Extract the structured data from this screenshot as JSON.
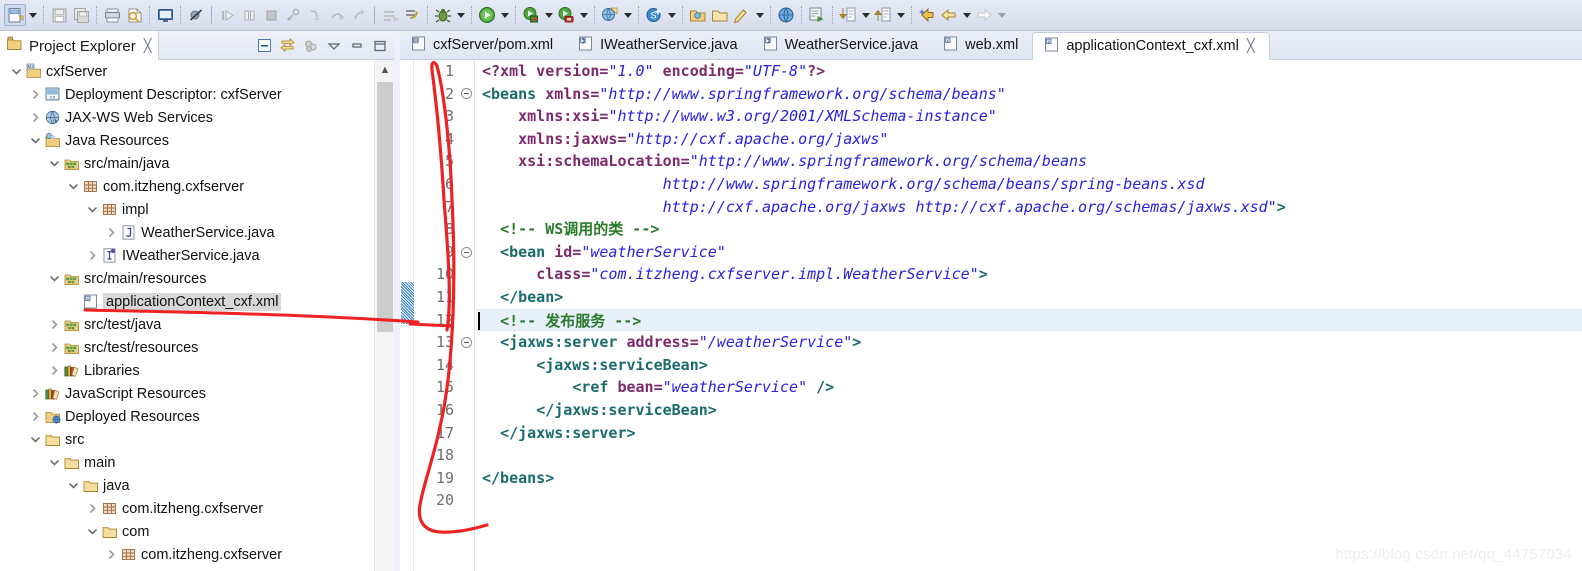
{
  "toolbar": {
    "groups": [
      {
        "name": "new",
        "items": [
          {
            "icon": "new-file-icon",
            "label": "New",
            "selected": true
          },
          {
            "icon": "chevron-down-icon",
            "label": "New menu",
            "type": "arrow"
          }
        ]
      },
      {
        "name": "save",
        "items": [
          {
            "icon": "save-icon",
            "label": "Save",
            "disabled": true
          },
          {
            "icon": "save-all-icon",
            "label": "Save All",
            "disabled": true
          }
        ]
      },
      {
        "name": "print",
        "items": [
          {
            "icon": "print-icon",
            "label": "Print"
          },
          {
            "icon": "build-icon",
            "label": "Build"
          }
        ]
      },
      {
        "name": "console",
        "items": [
          {
            "icon": "console-icon",
            "label": "Open Console"
          }
        ]
      },
      {
        "name": "breakpoint",
        "items": [
          {
            "icon": "skip-breakpoints-icon",
            "label": "Skip All Breakpoints"
          }
        ]
      },
      {
        "name": "debug-step",
        "items": [
          {
            "icon": "resume-icon",
            "label": "Resume",
            "disabled": true
          },
          {
            "icon": "suspend-icon",
            "label": "Suspend",
            "disabled": true
          },
          {
            "icon": "terminate-icon",
            "label": "Terminate",
            "disabled": true
          },
          {
            "icon": "disconnect-icon",
            "label": "Disconnect",
            "disabled": true
          },
          {
            "icon": "step-into-icon",
            "label": "Step Into",
            "disabled": true
          },
          {
            "icon": "step-over-icon",
            "label": "Step Over",
            "disabled": true
          },
          {
            "icon": "step-return-icon",
            "label": "Step Return",
            "disabled": true
          }
        ]
      },
      {
        "name": "instance",
        "items": [
          {
            "icon": "new-instance-icon",
            "label": "New Instance",
            "disabled": true
          },
          {
            "icon": "deploy-icon",
            "label": "Deploy",
            "disabled": true
          }
        ]
      },
      {
        "name": "debug",
        "items": [
          {
            "icon": "debug-bug-icon",
            "label": "Debug"
          },
          {
            "icon": "chevron-down-icon",
            "label": "Debug menu",
            "type": "arrow"
          }
        ]
      },
      {
        "name": "run",
        "items": [
          {
            "icon": "run-icon",
            "label": "Run"
          },
          {
            "icon": "chevron-down-icon",
            "label": "Run menu",
            "type": "arrow"
          }
        ]
      },
      {
        "name": "run-server",
        "items": [
          {
            "icon": "run-server-icon",
            "label": "Run on Server"
          },
          {
            "icon": "chevron-down-icon",
            "label": "Run on Server menu",
            "type": "arrow"
          }
        ]
      },
      {
        "name": "stop-server",
        "items": [
          {
            "icon": "stop-server-icon",
            "label": "Stop Server"
          },
          {
            "icon": "chevron-down-icon",
            "label": "Stop Server menu",
            "type": "arrow"
          }
        ]
      },
      {
        "name": "profile-server",
        "items": [
          {
            "icon": "profile-server-icon",
            "label": "Profile Server"
          },
          {
            "icon": "chevron-down-icon",
            "label": "Profile menu",
            "type": "arrow"
          }
        ]
      },
      {
        "name": "new-wizard",
        "items": [
          {
            "icon": "new-web-project-icon",
            "label": "New Web Project"
          },
          {
            "icon": "chevron-down-icon",
            "label": "New project menu",
            "type": "arrow"
          }
        ]
      },
      {
        "name": "search-svn",
        "items": [
          {
            "icon": "svn-icon",
            "label": "SVN"
          },
          {
            "icon": "chevron-down-icon",
            "label": "SVN menu",
            "type": "arrow"
          }
        ]
      },
      {
        "name": "open-type",
        "items": [
          {
            "icon": "open-type-icon",
            "label": "Open Type"
          },
          {
            "icon": "open-task-icon",
            "label": "Open Task"
          },
          {
            "icon": "new-java-class-icon",
            "label": "New Java Class"
          },
          {
            "icon": "chevron-down-icon",
            "label": "New class menu",
            "type": "arrow"
          }
        ]
      },
      {
        "name": "web-browser",
        "items": [
          {
            "icon": "web-browser-icon",
            "label": "Open Web Browser"
          }
        ]
      },
      {
        "name": "search",
        "items": [
          {
            "icon": "search-icon",
            "label": "Search"
          }
        ]
      },
      {
        "name": "next-annotation",
        "items": [
          {
            "icon": "next-annotation-icon",
            "label": "Next Annotation"
          },
          {
            "icon": "chevron-down-icon",
            "label": "Next annotation menu",
            "type": "arrow"
          }
        ]
      },
      {
        "name": "prev-annotation",
        "items": [
          {
            "icon": "previous-annotation-icon",
            "label": "Previous Annotation"
          },
          {
            "icon": "chevron-down-icon",
            "label": "Previous annotation menu",
            "type": "arrow"
          }
        ]
      },
      {
        "name": "nav-history",
        "items": [
          {
            "icon": "last-edit-location-icon",
            "label": "Last Edit Location"
          },
          {
            "icon": "back-icon",
            "label": "Back"
          },
          {
            "icon": "chevron-down-icon",
            "label": "Back menu",
            "type": "arrow"
          },
          {
            "icon": "forward-icon",
            "label": "Forward",
            "disabled": true
          },
          {
            "icon": "chevron-down-icon",
            "label": "Forward menu",
            "type": "arrow",
            "disabled": true
          }
        ]
      }
    ]
  },
  "explorer": {
    "title": "Project Explorer",
    "title_icon": "project-explorer-icon",
    "close_glyph": "╳",
    "tools": [
      {
        "icon": "collapse-all-icon",
        "label": "Collapse All"
      },
      {
        "icon": "link-with-editor-icon",
        "label": "Link with Editor"
      },
      {
        "icon": "focus-on-active-task-icon",
        "label": "Focus on Active Task",
        "disabled": true
      },
      {
        "icon": "view-menu-icon",
        "label": "View Menu"
      },
      {
        "icon": "minimize-icon",
        "label": "Minimize"
      },
      {
        "icon": "maximize-icon",
        "label": "Maximize"
      }
    ],
    "tree": [
      {
        "label": "cxfServer",
        "indent": 0,
        "twisty": "down",
        "icon": "maven-java-project-icon"
      },
      {
        "label": "Deployment Descriptor: cxfServer",
        "indent": 1,
        "twisty": "right",
        "icon": "deployment-descriptor-icon"
      },
      {
        "label": "JAX-WS Web Services",
        "indent": 1,
        "twisty": "right",
        "icon": "jaxws-web-services-icon"
      },
      {
        "label": "Java Resources",
        "indent": 1,
        "twisty": "down",
        "icon": "java-resources-icon"
      },
      {
        "label": "src/main/java",
        "indent": 2,
        "twisty": "down",
        "icon": "source-folder-icon"
      },
      {
        "label": "com.itzheng.cxfserver",
        "indent": 3,
        "twisty": "down",
        "icon": "package-icon"
      },
      {
        "label": "impl",
        "indent": 4,
        "twisty": "down",
        "icon": "package-icon"
      },
      {
        "label": "WeatherService.java",
        "indent": 5,
        "twisty": "right",
        "icon": "java-class-icon"
      },
      {
        "label": "IWeatherService.java",
        "indent": 4,
        "twisty": "right",
        "icon": "java-interface-icon"
      },
      {
        "label": "src/main/resources",
        "indent": 2,
        "twisty": "down",
        "icon": "source-folder-icon"
      },
      {
        "label": "applicationContext_cxf.xml",
        "indent": 3,
        "twisty": "none",
        "icon": "xml-file-icon",
        "selected": true
      },
      {
        "label": "src/test/java",
        "indent": 2,
        "twisty": "right",
        "icon": "source-folder-icon"
      },
      {
        "label": "src/test/resources",
        "indent": 2,
        "twisty": "right",
        "icon": "source-folder-icon"
      },
      {
        "label": "Libraries",
        "indent": 2,
        "twisty": "right",
        "icon": "libraries-icon"
      },
      {
        "label": "JavaScript Resources",
        "indent": 1,
        "twisty": "right",
        "icon": "libraries-icon"
      },
      {
        "label": "Deployed Resources",
        "indent": 1,
        "twisty": "right",
        "icon": "deployed-resources-icon"
      },
      {
        "label": "src",
        "indent": 1,
        "twisty": "down",
        "icon": "folder-icon"
      },
      {
        "label": "main",
        "indent": 2,
        "twisty": "down",
        "icon": "folder-icon"
      },
      {
        "label": "java",
        "indent": 3,
        "twisty": "down",
        "icon": "folder-icon"
      },
      {
        "label": "com.itzheng.cxfserver",
        "indent": 4,
        "twisty": "right",
        "icon": "package-icon"
      },
      {
        "label": "com",
        "indent": 4,
        "twisty": "down",
        "icon": "folder-icon"
      },
      {
        "label": "com.itzheng.cxfserver",
        "indent": 5,
        "twisty": "right",
        "icon": "package-icon"
      }
    ]
  },
  "editor": {
    "tabs": [
      {
        "label": "cxfServer/pom.xml",
        "icon": "maven-pom-icon",
        "active": false
      },
      {
        "label": "IWeatherService.java",
        "icon": "java-file-icon",
        "active": false
      },
      {
        "label": "WeatherService.java",
        "icon": "java-file-icon",
        "active": false
      },
      {
        "label": "web.xml",
        "icon": "xml-file-icon",
        "active": false
      },
      {
        "label": "applicationContext_cxf.xml",
        "icon": "xml-file-icon",
        "active": true,
        "close_glyph": "╳"
      }
    ],
    "current_line": 12,
    "total_lines": 20,
    "fold_lines": [
      2,
      9,
      13
    ],
    "line_numbers": [
      "1",
      "2",
      "3",
      "4",
      "5",
      "6",
      "7",
      "8",
      "9",
      "10",
      "11",
      "12",
      "13",
      "14",
      "15",
      "16",
      "17",
      "18",
      "19",
      "20"
    ],
    "lines": [
      {
        "n": 1,
        "tokens": [
          {
            "t": "pi",
            "s": "<?xml version="
          },
          {
            "t": "val",
            "s": "\"1.0\""
          },
          {
            "t": "pi",
            "s": " encoding="
          },
          {
            "t": "val",
            "s": "\"UTF-8\""
          },
          {
            "t": "pi",
            "s": "?>"
          }
        ]
      },
      {
        "n": 2,
        "tokens": [
          {
            "t": "tag",
            "s": "<beans "
          },
          {
            "t": "attr",
            "s": "xmlns="
          },
          {
            "t": "val",
            "s": "\"http://www.springframework.org/schema/beans\""
          }
        ]
      },
      {
        "n": 3,
        "tokens": [
          {
            "t": "plain",
            "s": "    "
          },
          {
            "t": "attr",
            "s": "xmlns:xsi="
          },
          {
            "t": "val",
            "s": "\"http://www.w3.org/2001/XMLSchema-instance\""
          }
        ]
      },
      {
        "n": 4,
        "tokens": [
          {
            "t": "plain",
            "s": "    "
          },
          {
            "t": "attr",
            "s": "xmlns:jaxws="
          },
          {
            "t": "val",
            "s": "\"http://cxf.apache.org/jaxws\""
          }
        ]
      },
      {
        "n": 5,
        "tokens": [
          {
            "t": "plain",
            "s": "    "
          },
          {
            "t": "attr",
            "s": "xsi:schemaLocation="
          },
          {
            "t": "val",
            "s": "\"http://www.springframework.org/schema/beans"
          }
        ]
      },
      {
        "n": 6,
        "tokens": [
          {
            "t": "plain",
            "s": "                    "
          },
          {
            "t": "val",
            "s": "http://www.springframework.org/schema/beans/spring-beans.xsd"
          }
        ]
      },
      {
        "n": 7,
        "tokens": [
          {
            "t": "plain",
            "s": "                    "
          },
          {
            "t": "val",
            "s": "http://cxf.apache.org/jaxws http://cxf.apache.org/schemas/jaxws.xsd\""
          },
          {
            "t": "tag",
            "s": ">"
          }
        ]
      },
      {
        "n": 8,
        "tokens": [
          {
            "t": "plain",
            "s": "  "
          },
          {
            "t": "cmt",
            "s": "<!-- WS调用的类 -->"
          }
        ]
      },
      {
        "n": 9,
        "tokens": [
          {
            "t": "plain",
            "s": "  "
          },
          {
            "t": "tag",
            "s": "<bean "
          },
          {
            "t": "attr",
            "s": "id="
          },
          {
            "t": "val",
            "s": "\"weatherService\""
          }
        ]
      },
      {
        "n": 10,
        "tokens": [
          {
            "t": "plain",
            "s": "      "
          },
          {
            "t": "attr",
            "s": "class="
          },
          {
            "t": "val",
            "s": "\"com.itzheng.cxfserver.impl.WeatherService\""
          },
          {
            "t": "tag",
            "s": ">"
          }
        ]
      },
      {
        "n": 11,
        "tokens": [
          {
            "t": "plain",
            "s": "  "
          },
          {
            "t": "tag",
            "s": "</bean>"
          }
        ]
      },
      {
        "n": 12,
        "tokens": [
          {
            "t": "plain",
            "s": "  "
          },
          {
            "t": "cmt",
            "s": "<!-- 发布服务 -->"
          }
        ],
        "current": true
      },
      {
        "n": 13,
        "tokens": [
          {
            "t": "plain",
            "s": "  "
          },
          {
            "t": "tag",
            "s": "<jaxws:server "
          },
          {
            "t": "attr",
            "s": "address="
          },
          {
            "t": "val",
            "s": "\"/weatherService\""
          },
          {
            "t": "tag",
            "s": ">"
          }
        ]
      },
      {
        "n": 14,
        "tokens": [
          {
            "t": "plain",
            "s": "      "
          },
          {
            "t": "tag",
            "s": "<jaxws:serviceBean>"
          }
        ]
      },
      {
        "n": 15,
        "tokens": [
          {
            "t": "plain",
            "s": "          "
          },
          {
            "t": "tag",
            "s": "<ref "
          },
          {
            "t": "attr",
            "s": "bean="
          },
          {
            "t": "val",
            "s": "\"weatherService\""
          },
          {
            "t": "tag",
            "s": " />"
          }
        ]
      },
      {
        "n": 16,
        "tokens": [
          {
            "t": "plain",
            "s": "      "
          },
          {
            "t": "tag",
            "s": "</jaxws:serviceBean>"
          }
        ]
      },
      {
        "n": 17,
        "tokens": [
          {
            "t": "plain",
            "s": "  "
          },
          {
            "t": "tag",
            "s": "</jaxws:server>"
          }
        ]
      },
      {
        "n": 18,
        "tokens": [
          {
            "t": "plain",
            "s": ""
          }
        ]
      },
      {
        "n": 19,
        "tokens": [
          {
            "t": "tag",
            "s": "</beans>"
          }
        ]
      },
      {
        "n": 20,
        "tokens": [
          {
            "t": "plain",
            "s": ""
          }
        ]
      }
    ]
  },
  "annotation": {
    "color": "#ee2222",
    "description": "hand-drawn red curve from applicationContext_cxf.xml in tree to line 12 in editor"
  },
  "watermark": {
    "text": "https://blog.csdn.net/qq_44757034"
  },
  "colors": {
    "toolbar_bg": "#dfe4f0",
    "tab_active_bg": "#ffffff",
    "selection_bg": "#d7d7d7",
    "current_line_bg": "#e8f0fb",
    "tag": "#1a6b6b",
    "attribute": "#7d2a6b",
    "value": "#2a21e0",
    "comment": "#2a7a2a",
    "line_number": "#6e6e6e",
    "annotation_red": "#ee2222",
    "marker_blue": "#2f7fd1"
  }
}
